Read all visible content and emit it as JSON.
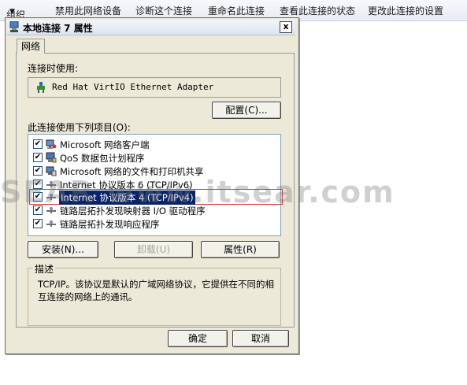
{
  "toolbar": {
    "organize": "组织",
    "disable_device": "禁用此网络设备",
    "diagnose": "诊断这个连接",
    "rename": "重命名此连接",
    "view_status": "查看此连接的状态",
    "change_settings": "更改此连接的设置"
  },
  "dialog": {
    "title": "本地连接 7 属性",
    "close_label": "x",
    "tab_network": "网络",
    "connect_using_label": "连接时使用:",
    "adapter_name": "Red Hat VirtIO Ethernet Adapter",
    "configure_button": "配置(C)...",
    "items_label": "此连接使用下列项目(O):",
    "items": [
      {
        "label": "Microsoft 网络客户端",
        "checked": true,
        "icon": "network-client-icon"
      },
      {
        "label": "QoS 数据包计划程序",
        "checked": true,
        "icon": "qos-icon"
      },
      {
        "label": "Microsoft 网络的文件和打印机共享",
        "checked": true,
        "icon": "file-share-icon"
      },
      {
        "label": "Internet 协议版本 6 (TCP/IPv6)",
        "checked": true,
        "icon": "protocol-icon"
      },
      {
        "label": "Internet 协议版本 4 (TCP/IPv4)",
        "checked": true,
        "icon": "protocol-icon",
        "selected": true
      },
      {
        "label": "链路层拓扑发现映射器 I/O 驱动程序",
        "checked": true,
        "icon": "protocol-icon"
      },
      {
        "label": "链路层拓扑发现响应程序",
        "checked": true,
        "icon": "protocol-icon"
      }
    ],
    "install_button": "安装(N)...",
    "uninstall_button": "卸载(U)",
    "properties_button": "属性(R)",
    "description_legend": "描述",
    "description_text": "TCP/IP。该协议是默认的广域网络协议，它提供在不同的相互连接的网络上的通讯。",
    "ok_button": "确定",
    "cancel_button": "取消"
  },
  "watermark": "SEAR www.itsear.com",
  "colors": {
    "selection": "#0a2469",
    "highlight_border": "#dd3333",
    "dialog_bg": "#ece9d8"
  }
}
